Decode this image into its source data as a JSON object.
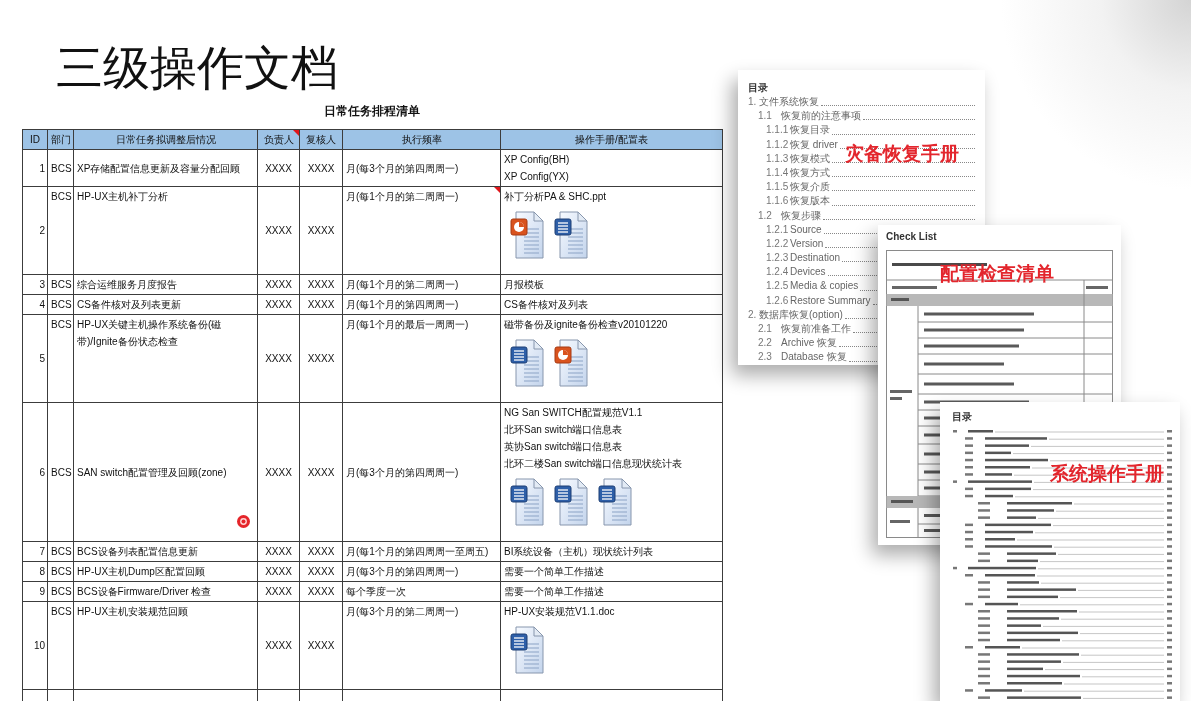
{
  "slide": {
    "title": "三级操作文档"
  },
  "schedule": {
    "caption": "日常任务排程清单",
    "columns": [
      {
        "label": "ID",
        "comment": false
      },
      {
        "label": "部门",
        "comment": false
      },
      {
        "label": "日常任务拟调整后情况",
        "comment": false
      },
      {
        "label": "负责人",
        "comment": true
      },
      {
        "label": "复核人",
        "comment": false
      },
      {
        "label": "执行频率",
        "comment": false
      },
      {
        "label": "操作手册/配置表",
        "comment": false
      }
    ],
    "rows": [
      {
        "id": "1",
        "department": "BCS",
        "task": "XP存储配置信息更新及容量分配回顾",
        "owner": "XXXX",
        "reviewer": "XXXX",
        "frequency": "月(每3个月的第四周周一)",
        "frequency_comment": false,
        "manuals": [
          "XP Config(BH)",
          "XP Config(YX)"
        ]
      },
      {
        "id": "2",
        "department": "BCS",
        "task": "HP-UX主机补丁分析",
        "owner": "XXXX",
        "reviewer": "XXXX",
        "frequency": "月(每1个月的第二周周一)",
        "frequency_comment": true,
        "manuals": [
          "补丁分析PA & SHC.ppt"
        ],
        "attachments": [
          {
            "kind": "ppt"
          },
          {
            "kind": "word"
          }
        ]
      },
      {
        "id": "3",
        "department": "BCS",
        "task": "综合运维服务月度报告",
        "owner": "XXXX",
        "reviewer": "XXXX",
        "frequency": "月(每1个月的第二周周一)",
        "frequency_comment": false,
        "manuals": [
          "月报模板"
        ]
      },
      {
        "id": "4",
        "department": "BCS",
        "task": "CS备件核对及列表更新",
        "owner": "XXXX",
        "reviewer": "XXXX",
        "frequency": "月(每1个月的第四周周一)",
        "frequency_comment": false,
        "manuals": [
          "CS备件核对及列表"
        ]
      },
      {
        "id": "5",
        "department": "BCS",
        "task": "HP-UX关键主机操作系统备份(磁带)/Ignite备份状态检查",
        "owner": "XXXX",
        "reviewer": "XXXX",
        "frequency": "月(每1个月的最后一周周一)",
        "frequency_comment": false,
        "manuals": [
          "磁带备份及ignite备份检查v20101220"
        ],
        "attachments": [
          {
            "kind": "word"
          },
          {
            "kind": "ppt"
          }
        ]
      },
      {
        "id": "6",
        "department": "BCS",
        "task": "SAN switch配置管理及回顾(zone)",
        "owner": "XXXX",
        "reviewer": "XXXX",
        "frequency": "月(每3个月的第四周周一)",
        "frequency_comment": false,
        "manuals": [
          "NG San SWITCH配置规范V1.1",
          "北环San switch端口信息表",
          "英协San switch端口信息表",
          "北环二楼San switch端口信息现状统计表"
        ],
        "attachments": [
          {
            "kind": "word"
          },
          {
            "kind": "word"
          },
          {
            "kind": "word"
          }
        ]
      },
      {
        "id": "7",
        "department": "BCS",
        "task": "BCS设备列表配置信息更新",
        "owner": "XXXX",
        "reviewer": "XXXX",
        "frequency": "月(每1个月的第四周周一至周五)",
        "frequency_comment": false,
        "manuals": [
          "BI系统设备（主机）现状统计列表"
        ]
      },
      {
        "id": "8",
        "department": "BCS",
        "task": "HP-UX主机Dump区配置回顾",
        "owner": "XXXX",
        "reviewer": "XXXX",
        "frequency": "月(每3个月的第四周周一)",
        "frequency_comment": false,
        "manuals": [
          "需要一个简单工作描述"
        ]
      },
      {
        "id": "9",
        "department": "BCS",
        "task": "BCS设备Firmware/Driver 检查",
        "owner": "XXXX",
        "reviewer": "XXXX",
        "frequency": "每个季度一次",
        "frequency_comment": false,
        "manuals": [
          "需要一个简单工作描述"
        ]
      },
      {
        "id": "10",
        "department": "BCS",
        "task": "HP-UX主机安装规范回顾",
        "owner": "XXXX",
        "reviewer": "XXXX",
        "frequency": "月(每3个月的第二周周一)",
        "frequency_comment": false,
        "manuals": [
          "HP-UX安装规范V1.1.doc"
        ],
        "attachments": [
          {
            "kind": "word"
          }
        ]
      }
    ]
  },
  "documents": [
    {
      "kind": "toc",
      "heading": "目录",
      "stamp": "灾备恢复手册",
      "entries": [
        {
          "number": "1.",
          "title": "文件系统恢复",
          "children": [
            {
              "number": "1.1",
              "title": "恢复前的注意事项",
              "children": [
                {
                  "number": "1.1.1",
                  "title": "恢复目录"
                },
                {
                  "number": "1.1.2",
                  "title": "恢复 driver"
                },
                {
                  "number": "1.1.3",
                  "title": "恢复模式"
                },
                {
                  "number": "1.1.4",
                  "title": "恢复方式"
                },
                {
                  "number": "1.1.5",
                  "title": "恢复介质"
                },
                {
                  "number": "1.1.6",
                  "title": "恢复版本"
                }
              ]
            },
            {
              "number": "1.2",
              "title": "恢复步骤",
              "children": [
                {
                  "number": "1.2.1",
                  "title": "Source"
                },
                {
                  "number": "1.2.2",
                  "title": "Version"
                },
                {
                  "number": "1.2.3",
                  "title": "Destination"
                },
                {
                  "number": "1.2.4",
                  "title": "Devices"
                },
                {
                  "number": "1.2.5",
                  "title": "Media & copies"
                },
                {
                  "number": "1.2.6",
                  "title": "Restore Summary"
                }
              ]
            }
          ]
        },
        {
          "number": "2.",
          "title": "数据库恢复(option)",
          "children": [
            {
              "number": "2.1",
              "title": "恢复前准备工作"
            },
            {
              "number": "2.2",
              "title": "Archive 恢复"
            },
            {
              "number": "2.3",
              "title": "Database 恢复"
            }
          ]
        }
      ]
    },
    {
      "kind": "checklist",
      "heading": "Check List",
      "stamp": "配置检查清单"
    },
    {
      "kind": "toc_outline",
      "heading": "目录",
      "stamp": "系统操作手册"
    }
  ]
}
